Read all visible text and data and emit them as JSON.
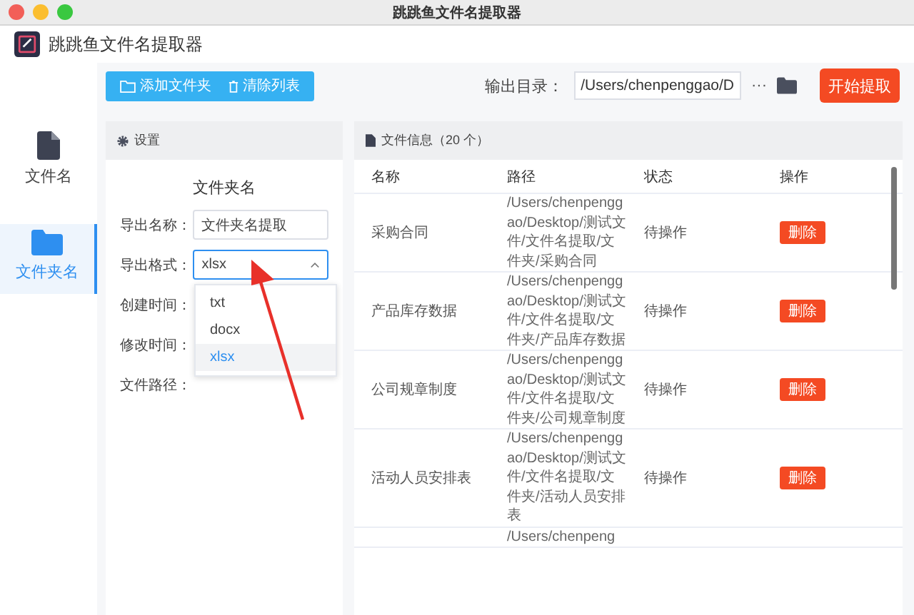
{
  "window": {
    "title": "跳跳鱼文件名提取器"
  },
  "app": {
    "name": "跳跳鱼文件名提取器"
  },
  "sidebar": {
    "items": [
      {
        "label": "文件名",
        "kind": "file",
        "selected": false
      },
      {
        "label": "文件夹名",
        "kind": "folder",
        "selected": true
      }
    ]
  },
  "toolbar": {
    "buttons": [
      {
        "label": "添加文件夹",
        "kind": "add"
      },
      {
        "label": "清除列表",
        "kind": "clear"
      }
    ],
    "output_label": "输出目录：",
    "output_path": "/Users/chenpenggao/D",
    "more": "···",
    "start_button": "开始提取"
  },
  "settings": {
    "header": "设置",
    "section_title": "文件夹名",
    "fields": [
      {
        "label": "导出名称：",
        "kind": "text",
        "value": "文件夹名提取"
      },
      {
        "label": "导出格式：",
        "kind": "select",
        "value": "xlsx",
        "expanded": true,
        "options": [
          {
            "label": "txt",
            "selected": false
          },
          {
            "label": "docx",
            "selected": false
          },
          {
            "label": "xlsx",
            "selected": true
          }
        ]
      },
      {
        "label": "创建时间：",
        "kind": "hidden"
      },
      {
        "label": "修改时间：",
        "kind": "hidden"
      },
      {
        "label": "文件路径：",
        "kind": "hidden"
      }
    ]
  },
  "file_table": {
    "header": "文件信息（20 个）",
    "columns": [
      "名称",
      "路径",
      "状态",
      "操作"
    ],
    "rows": [
      {
        "name": "采购合同",
        "path": "/Users/chenpenggao/Desktop/测试文件/文件名提取/文件夹/采购合同",
        "status": "待操作",
        "action": "删除"
      },
      {
        "name": "产品库存数据",
        "path": "/Users/chenpenggao/Desktop/测试文件/文件名提取/文件夹/产品库存数据",
        "status": "待操作",
        "action": "删除"
      },
      {
        "name": "公司规章制度",
        "path": "/Users/chenpenggao/Desktop/测试文件/文件名提取/文件夹/公司规章制度",
        "status": "待操作",
        "action": "删除"
      },
      {
        "name": "活动人员安排表",
        "path": "/Users/chenpenggao/Desktop/测试文件/文件名提取/文件夹/活动人员安排表",
        "status": "待操作",
        "action": "删除"
      },
      {
        "path": "/Users/chenpeng"
      }
    ]
  }
}
